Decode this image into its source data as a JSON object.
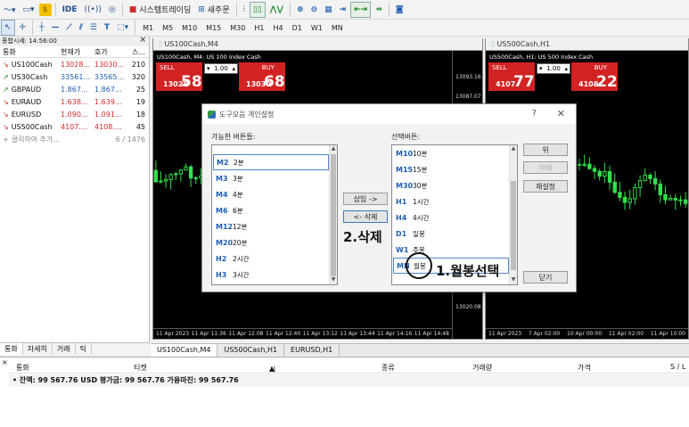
{
  "toolbar1": {
    "ide": "IDE",
    "algo_trading": "시스템트레이딩",
    "new_order": "새주문"
  },
  "timeframes": [
    "M1",
    "M5",
    "M10",
    "M15",
    "M30",
    "H1",
    "H4",
    "D1",
    "W1",
    "MN"
  ],
  "market_watch": {
    "title": "종합시세: 14:56:00",
    "close": "×",
    "columns": [
      "통화",
      "현재가",
      "호가",
      "스..."
    ],
    "rows": [
      {
        "symbol": "US100Cash",
        "bid": "13028...",
        "ask": "13030...",
        "spread": "210",
        "dir": "down"
      },
      {
        "symbol": "US30Cash",
        "bid": "33561...",
        "ask": "33565...",
        "spread": "320",
        "dir": "up"
      },
      {
        "symbol": "GBPAUD",
        "bid": "1.867...",
        "ask": "1.867...",
        "spread": "25",
        "dir": "up"
      },
      {
        "symbol": "EURAUD",
        "bid": "1.638...",
        "ask": "1.639...",
        "spread": "19",
        "dir": "down"
      },
      {
        "symbol": "EURUSD",
        "bid": "1.090...",
        "ask": "1.091...",
        "spread": "18",
        "dir": "down"
      },
      {
        "symbol": "US500Cash",
        "bid": "4107....",
        "ask": "4108....",
        "spread": "45",
        "dir": "down"
      }
    ],
    "add_label": "클릭하여 추가...",
    "count": "6 / 1476",
    "tabs": [
      "통화",
      "자세히",
      "거래",
      "틱"
    ]
  },
  "chart1": {
    "window_title": "US100Cash,M4",
    "symbol_label": "US100Cash, M4:  US 100 Index Cash",
    "sell": "SELL",
    "buy": "BUY",
    "lot": "1.00",
    "sell_small": "13028",
    "sell_big": "58",
    "buy_small": "13030",
    "buy_big": "68",
    "prices": [
      "13093.16",
      "13087.07",
      "13020.08"
    ],
    "times": [
      "11 Apr 2023",
      "11 Apr 11:36",
      "11 Apr 12:08",
      "11 Apr 12:40",
      "11 Apr 13:12",
      "11 Apr 13:44",
      "11 Apr 14:16",
      "11 Apr 14:48"
    ]
  },
  "chart2": {
    "window_title": "US500Cash,H1",
    "symbol_label": "US500Cash, H1:  US 500 Index Cash",
    "sell": "SELL",
    "buy": "BUY",
    "lot": "1.00",
    "sell_small": "4107",
    "sell_big": "77",
    "buy_small": "4108",
    "buy_big": "22",
    "times": [
      "11 Apr 2023",
      "7 Apr 02:00",
      "10 Apr 00:00",
      "11 Apr 02:00",
      "11 Apr 10:00"
    ]
  },
  "chart_tabs": [
    "US100Cash,M4",
    "US500Cash,H1",
    "EURUSD,H1"
  ],
  "terminal": {
    "columns": [
      "통화",
      "티켓",
      "시간",
      "종류",
      "거래량",
      "가격",
      "S / L"
    ],
    "balance_text": "잔액: 99 567.76 USD  평가금: 99 567.76  가용마진: 99 567.76"
  },
  "dialog": {
    "title": "도구모음 개인설정",
    "help": "?",
    "close": "✕",
    "available_label": "가능한 버튼들:",
    "selected_label": "선택버튼:",
    "available": [
      {
        "code": "M2",
        "name": "2분"
      },
      {
        "code": "M3",
        "name": "3분"
      },
      {
        "code": "M4",
        "name": "4분"
      },
      {
        "code": "M6",
        "name": "6분"
      },
      {
        "code": "M12",
        "name": "12분"
      },
      {
        "code": "M20",
        "name": "20분"
      },
      {
        "code": "H2",
        "name": "2시간"
      },
      {
        "code": "H3",
        "name": "3시간"
      }
    ],
    "selected": [
      {
        "code": "M10",
        "name": "10분"
      },
      {
        "code": "M15",
        "name": "15분"
      },
      {
        "code": "M30",
        "name": "30분"
      },
      {
        "code": "H1",
        "name": "1시간"
      },
      {
        "code": "H4",
        "name": "4시간"
      },
      {
        "code": "D1",
        "name": "일봉"
      },
      {
        "code": "W1",
        "name": "주봉"
      },
      {
        "code": "MN",
        "name": "월봉"
      }
    ],
    "insert": "삽입 ->",
    "delete": "<- 삭제",
    "up": "위",
    "down": "아래",
    "reset": "재설정",
    "close_btn": "닫기"
  },
  "annotations": {
    "step1": "1.월봉선택",
    "step2": "2.삭제"
  }
}
